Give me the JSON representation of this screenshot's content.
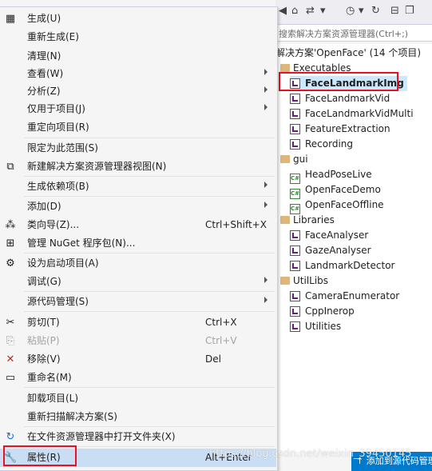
{
  "solution_explorer": {
    "search_placeholder": "搜索解决方案资源管理器(Ctrl+;)",
    "solution_label": "解决方案'OpenFace' (14 个项目)",
    "folders": [
      {
        "name": "Executables",
        "items": [
          "FaceLandmarkImg",
          "FaceLandmarkVid",
          "FaceLandmarkVidMulti",
          "FeatureExtraction",
          "Recording"
        ]
      },
      {
        "name": "gui",
        "items": [
          "HeadPoseLive",
          "OpenFaceDemo",
          "OpenFaceOffline"
        ]
      },
      {
        "name": "Libraries",
        "items": [
          "FaceAnalyser",
          "GazeAnalyser",
          "LandmarkDetector"
        ]
      },
      {
        "name": "UtilLibs",
        "items": [
          "CameraEnumerator",
          "CppInerop",
          "Utilities"
        ]
      }
    ],
    "selected_item": "FaceLandmarkImg",
    "status_text": "↑ 添加到源代码管理",
    "csharp_badge": "C#"
  },
  "context_menu": {
    "items": [
      {
        "label": "生成(U)",
        "icon": "build-icon"
      },
      {
        "label": "重新生成(E)"
      },
      {
        "label": "清理(N)"
      },
      {
        "label": "查看(W)",
        "submenu": true
      },
      {
        "label": "分析(Z)",
        "submenu": true
      },
      {
        "label": "仅用于项目(J)",
        "submenu": true
      },
      {
        "label": "重定向项目(R)"
      },
      {
        "label": "限定为此范围(S)"
      },
      {
        "label": "新建解决方案资源管理器视图(N)",
        "icon": "new-view-icon"
      },
      {
        "label": "生成依赖项(B)",
        "submenu": true
      },
      {
        "label": "添加(D)",
        "submenu": true
      },
      {
        "label": "类向导(Z)...",
        "shortcut": "Ctrl+Shift+X",
        "icon": "class-wizard-icon"
      },
      {
        "label": "管理 NuGet 程序包(N)...",
        "icon": "nuget-icon"
      },
      {
        "label": "设为启动项目(A)",
        "icon": "gear-icon"
      },
      {
        "label": "调试(G)",
        "submenu": true
      },
      {
        "label": "源代码管理(S)",
        "submenu": true
      },
      {
        "label": "剪切(T)",
        "shortcut": "Ctrl+X",
        "icon": "scissors-icon"
      },
      {
        "label": "粘贴(P)",
        "shortcut": "Ctrl+V",
        "icon": "paste-icon",
        "disabled": true
      },
      {
        "label": "移除(V)",
        "shortcut": "Del",
        "icon": "remove-icon"
      },
      {
        "label": "重命名(M)",
        "icon": "rename-icon"
      },
      {
        "label": "卸载项目(L)"
      },
      {
        "label": "重新扫描解决方案(S)"
      },
      {
        "label": "在文件资源管理器中打开文件夹(X)",
        "icon": "open-folder-icon"
      },
      {
        "label": "属性(R)",
        "shortcut": "Alt+Enter",
        "icon": "wrench-icon"
      }
    ]
  },
  "watermark": "https://blog.csdn.net/weixin_39450145",
  "colors": {
    "accent": "#007acc",
    "highlight_border": "#e81123",
    "selection": "#cce8ff",
    "remove_red": "#c42b1c"
  }
}
